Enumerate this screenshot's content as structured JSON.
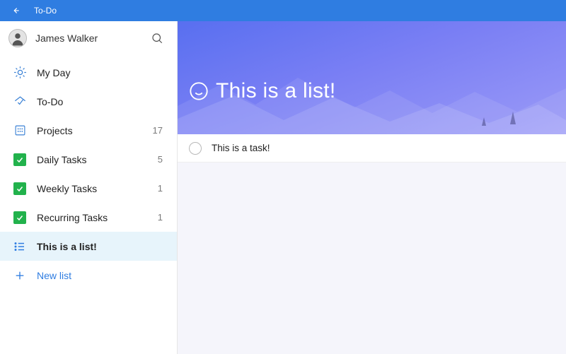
{
  "titlebar": {
    "title": "To-Do"
  },
  "user": {
    "name": "James Walker"
  },
  "sidebar": {
    "items": [
      {
        "icon": "sun",
        "label": "My Day",
        "count": ""
      },
      {
        "icon": "home",
        "label": "To-Do",
        "count": ""
      },
      {
        "icon": "grid",
        "label": "Projects",
        "count": "17"
      },
      {
        "icon": "check",
        "label": "Daily Tasks",
        "count": "5"
      },
      {
        "icon": "check",
        "label": "Weekly Tasks",
        "count": "1"
      },
      {
        "icon": "check",
        "label": "Recurring Tasks",
        "count": "1"
      },
      {
        "icon": "bullets",
        "label": "This is a list!",
        "count": "",
        "active": true
      }
    ],
    "newlist_label": "New list"
  },
  "main": {
    "list_title": "This is a list!",
    "tasks": [
      {
        "title": "This is a task!"
      }
    ]
  }
}
